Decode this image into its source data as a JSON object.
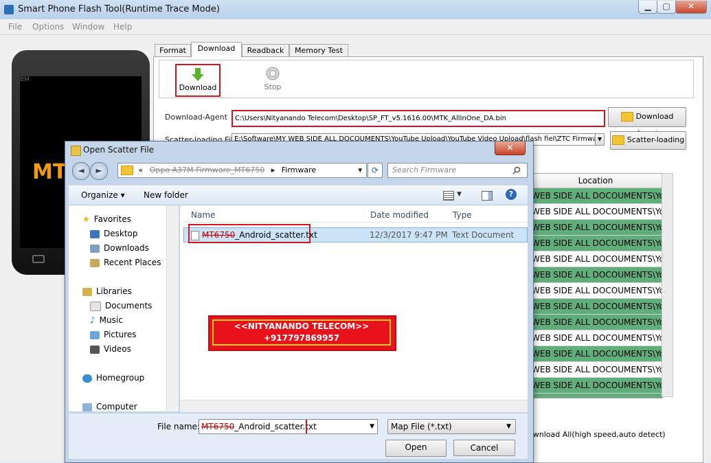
{
  "window": {
    "title": "Smart Phone Flash Tool(Runtime Trace Mode)",
    "minimize": "▁",
    "maximize": "▢",
    "close": "✕"
  },
  "menu": [
    "File",
    "Options",
    "Window",
    "Help"
  ],
  "phone": {
    "brand_text": "MT",
    "top_text": "BM"
  },
  "tabs": [
    "Format",
    "Download",
    "Readback",
    "Memory Test"
  ],
  "toolbar": {
    "download_label": "Download",
    "stop_label": "Stop"
  },
  "download_agent": {
    "label": "Download-Agent",
    "value": "C:\\Users\\Nityanando Telecom\\Desktop\\SP_FT_v5.1616.00\\MTK_AllInOne_DA.bin",
    "button": "Download Agent"
  },
  "scatter": {
    "label": "Scatter-loading File",
    "value": "E:\\Software\\MY WEB SIDE ALL DOCOUMENTS\\YouTube Upload\\YouTube Video Upload\\flash fiel\\ZTC Firmware",
    "button": "Scatter-loading"
  },
  "table": {
    "header": "Location",
    "rows": [
      "WEB SIDE ALL DOCOUMENTS\\Yo...",
      "WEB SIDE ALL DOCOUMENTS\\Yo...",
      "WEB SIDE ALL DOCOUMENTS\\Yo...",
      "WEB SIDE ALL DOCOUMENTS\\Yo...",
      "WEB SIDE ALL DOCOUMENTS\\Yo...",
      "WEB SIDE ALL DOCOUMENTS\\Yo...",
      "WEB SIDE ALL DOCOUMENTS\\Yo...",
      "WEB SIDE ALL DOCOUMENTS\\Yo...",
      "WEB SIDE ALL DOCOUMENTS\\Yo...",
      "WEB SIDE ALL DOCOUMENTS\\Yo...",
      "WEB SIDE ALL DOCOUMENTS\\Yo...",
      "WEB SIDE ALL DOCOUMENTS\\Yo...",
      "WEB SIDE ALL DOCOUMENTS\\Yo...",
      "WEB SIDE ALL DOCOUMENTS\\Yo..."
    ],
    "row_colors": [
      "g",
      "w",
      "g",
      "g",
      "w",
      "g",
      "w",
      "g",
      "g",
      "w",
      "g",
      "w",
      "g",
      "g"
    ]
  },
  "status_line": "ownload All(high speed,auto detect)",
  "dialog": {
    "title": "Open Scatter File",
    "close": "✕",
    "back": "◄",
    "forward": "►",
    "address_prefix": "«",
    "address_crumb1": "Oppo A37M Firmware_MT6750",
    "address_sep": "▸",
    "address_crumb2": "Firmware",
    "address_dropdown": "▾",
    "refresh": "⟳",
    "search_placeholder": "Search Firmware",
    "organize": "Organize ▾",
    "new_folder": "New folder",
    "sidebar": {
      "favorites": "Favorites",
      "desktop": "Desktop",
      "downloads": "Downloads",
      "recent": "Recent Places",
      "libraries": "Libraries",
      "documents": "Documents",
      "music": "Music",
      "pictures": "Pictures",
      "videos": "Videos",
      "homegroup": "Homegroup",
      "computer": "Computer"
    },
    "columns": {
      "name": "Name",
      "date": "Date modified",
      "type": "Type"
    },
    "file": {
      "name_prefix": "MT6750",
      "name_suffix": "_Android_scatter.txt",
      "date": "12/3/2017 9:47 PM",
      "type": "Text Document"
    },
    "watermark": {
      "line1": "<<NITYANANDO TELECOM>>",
      "line2": "+917797869957"
    },
    "filename_label": "File name:",
    "filename_prefix": "MT6750",
    "filename_suffix": "_Android_scatter.txt",
    "filetype": "Map File (*.txt)",
    "open": "Open",
    "cancel": "Cancel"
  },
  "colors": {
    "highlight_red": "#d2161f",
    "row_green": "#5fae7b",
    "title_blue": "#b9d1ea"
  }
}
